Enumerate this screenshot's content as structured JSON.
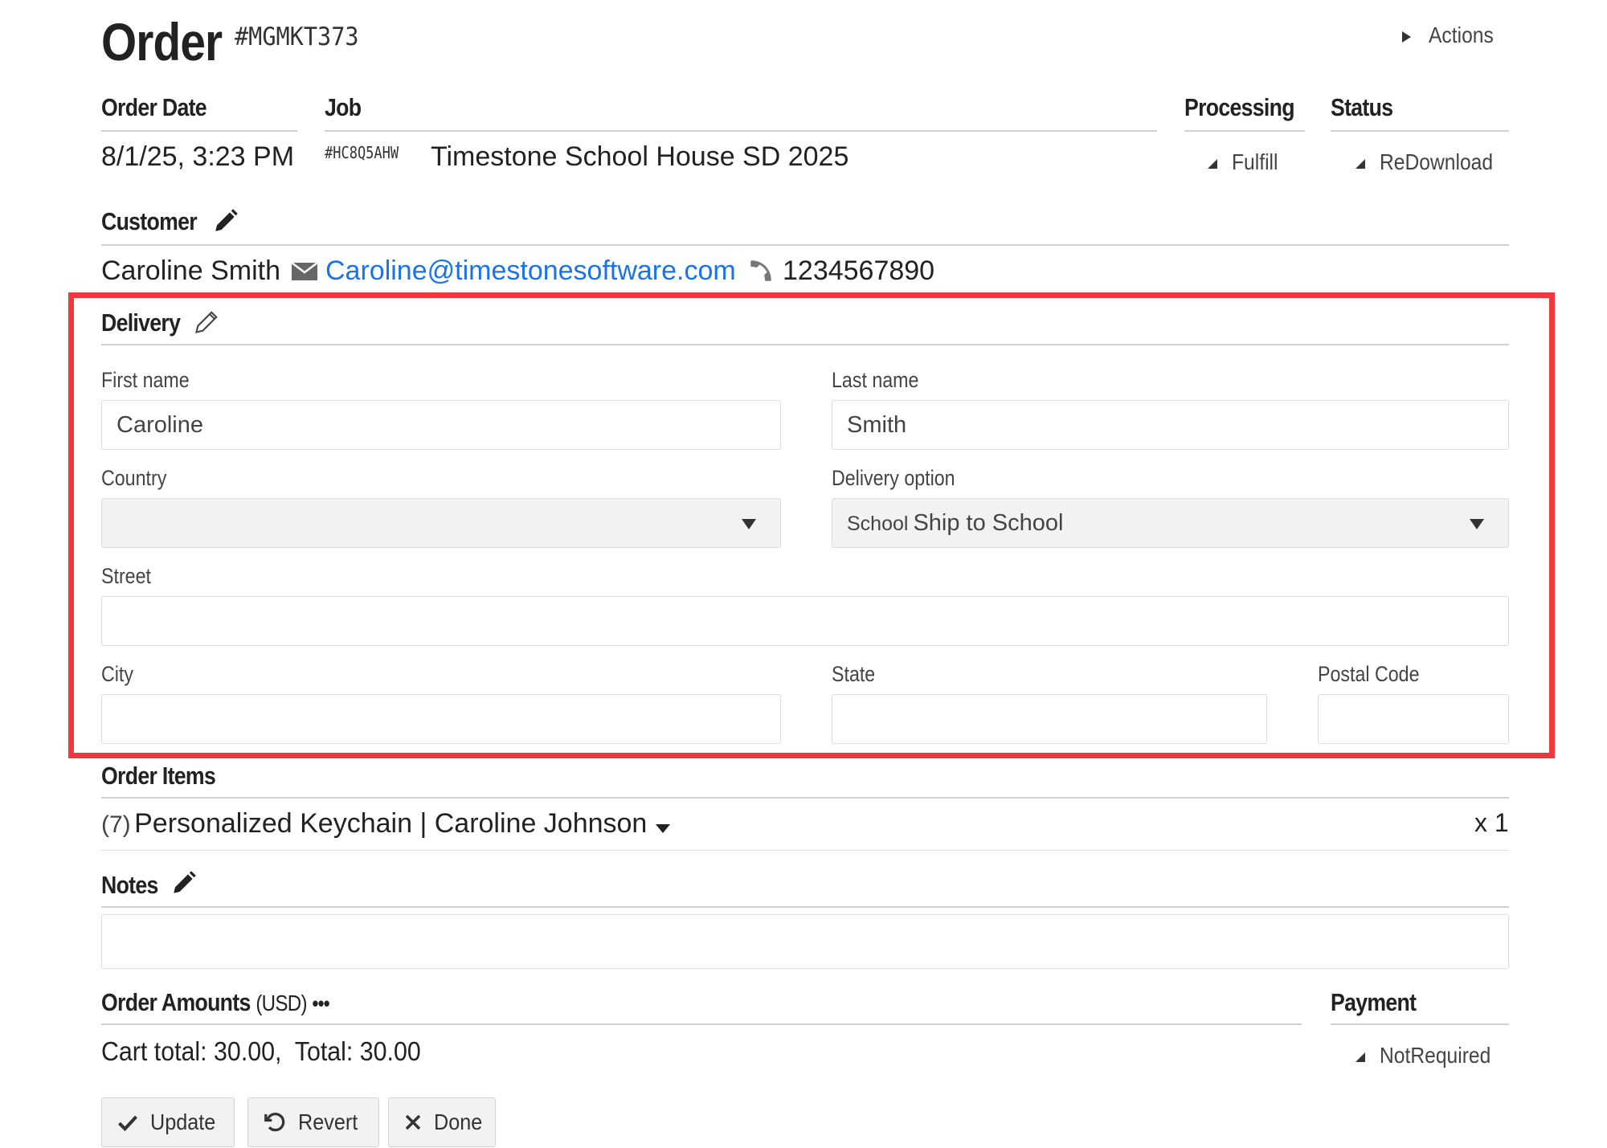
{
  "header": {
    "title": "Order",
    "order_number": "#MGMKT373",
    "actions_label": "Actions"
  },
  "order_info": {
    "order_date_label": "Order Date",
    "order_date": "8/1/25, 3:23 PM",
    "job_label": "Job",
    "job_id": "#HC8Q5AHW",
    "job_name": "Timestone School House SD 2025",
    "processing_label": "Processing",
    "processing_value": "Fulfill",
    "status_label": "Status",
    "status_value": "ReDownload"
  },
  "customer": {
    "label": "Customer",
    "name": "Caroline Smith",
    "email": "Caroline@timestonesoftware.com",
    "phone": "1234567890"
  },
  "delivery": {
    "label": "Delivery",
    "first_name_label": "First name",
    "first_name": "Caroline",
    "last_name_label": "Last name",
    "last_name": "Smith",
    "country_label": "Country",
    "country": "",
    "delivery_option_label": "Delivery option",
    "delivery_option_tag": "School",
    "delivery_option": "Ship to School",
    "street_label": "Street",
    "street": "",
    "city_label": "City",
    "city": "",
    "state_label": "State",
    "state": "",
    "postal_label": "Postal Code",
    "postal": ""
  },
  "order_items": {
    "label": "Order Items",
    "items": [
      {
        "count": "(7)",
        "name": "Personalized Keychain | Caroline Johnson",
        "qty": "x 1"
      }
    ]
  },
  "notes": {
    "label": "Notes",
    "value": ""
  },
  "amounts": {
    "label": "Order Amounts",
    "currency": "(USD)",
    "more": "•••",
    "summary": "Cart total: 30.00,  Total: 30.00",
    "payment_label": "Payment",
    "payment_value": "NotRequired"
  },
  "buttons": {
    "update": "Update",
    "revert": "Revert",
    "done": "Done"
  },
  "colors": {
    "highlight": "#f0373c",
    "link": "#1a73e8"
  }
}
